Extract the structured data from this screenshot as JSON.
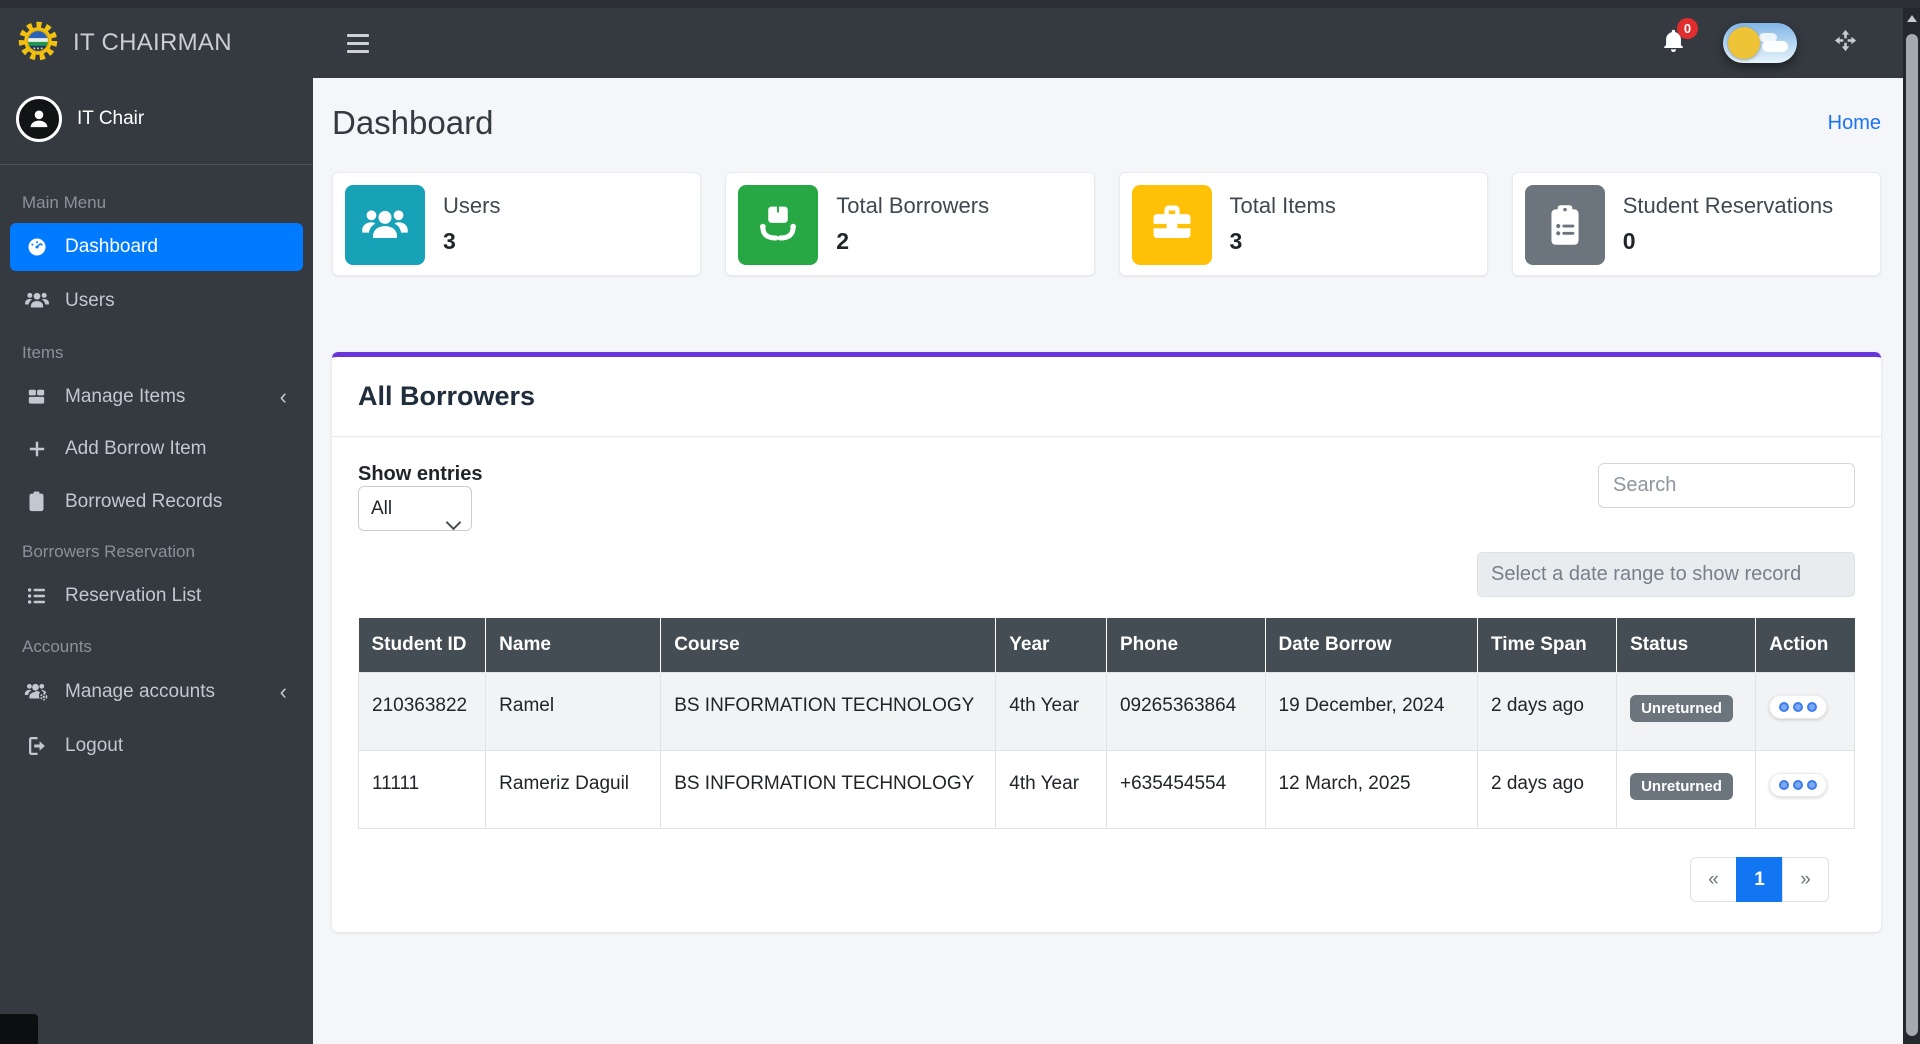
{
  "colors": {
    "navbar_bg": "#343a40",
    "sidebar_bg": "#343a40",
    "active_item_blue": "#007bff",
    "card_accent_purple": "#6935d8",
    "stat_teal": "#17a2b8",
    "stat_green": "#28a745",
    "stat_yellow": "#ffc107",
    "stat_gray": "#6c757d",
    "badge_red": "#e02d2d",
    "table_header_bg": "#444c54",
    "status_badge_gray": "#6c757d",
    "pagination_active_blue": "#1276f3",
    "link_blue": "#1b73f0"
  },
  "topbar": {
    "notification_count": "0",
    "icons": [
      "hamburger-icon",
      "bell-icon",
      "day-night-toggle",
      "expand-icon"
    ]
  },
  "brand": {
    "title": "IT CHAIRMAN",
    "logo_icon": "university-seal-gear-logo"
  },
  "user_panel": {
    "name": "IT Chair",
    "avatar_icon": "person-icon"
  },
  "sidebar": {
    "sections": [
      {
        "header": "Main Menu",
        "items": [
          {
            "label": "Dashboard",
            "icon": "tachometer-icon",
            "active": true
          },
          {
            "label": "Users",
            "icon": "users-icon"
          }
        ]
      },
      {
        "header": "Items",
        "items": [
          {
            "label": "Manage Items",
            "icon": "box-icon",
            "chevron": "‹"
          },
          {
            "label": "Add Borrow Item",
            "icon": "plus-icon"
          },
          {
            "label": "Borrowed Records",
            "icon": "clipboard-icon"
          }
        ]
      },
      {
        "header": "Borrowers Reservation",
        "items": [
          {
            "label": "Reservation List",
            "icon": "list-icon"
          }
        ]
      },
      {
        "header": "Accounts",
        "items": [
          {
            "label": "Manage accounts",
            "icon": "users-gear-icon",
            "chevron": "‹"
          },
          {
            "label": "Logout",
            "icon": "logout-icon"
          }
        ]
      }
    ]
  },
  "content_header": {
    "title": "Dashboard",
    "home_link": "Home"
  },
  "stat_cards": [
    {
      "label": "Users",
      "value": "3",
      "icon": "users-icon",
      "color": "#17a2b8"
    },
    {
      "label": "Total Borrowers",
      "value": "2",
      "icon": "hand-holding-box-icon",
      "color": "#28a745"
    },
    {
      "label": "Total Items",
      "value": "3",
      "icon": "toolbox-icon",
      "color": "#ffc107"
    },
    {
      "label": "Student Reservations",
      "value": "0",
      "icon": "clipboard-list-icon",
      "color": "#6c757d"
    }
  ],
  "borrowers": {
    "title": "All Borrowers",
    "show_entries_label": "Show entries",
    "entries_selected": "All",
    "search_placeholder": "Search",
    "date_range_placeholder": "Select a date range to show record",
    "table": {
      "columns": [
        "Student ID",
        "Name",
        "Course",
        "Year",
        "Phone",
        "Date Borrow",
        "Time Span",
        "Status",
        "Action"
      ],
      "rows": [
        {
          "student_id": "210363822",
          "name": "Ramel",
          "course": "BS INFORMATION TECHNOLOGY",
          "year": "4th Year",
          "phone": "09265363864",
          "date_borrow": "19 December, 2024",
          "time_span": "2 days ago",
          "status": "Unreturned"
        },
        {
          "student_id": "11111",
          "name": "Rameriz Daguil",
          "course": "BS INFORMATION TECHNOLOGY",
          "year": "4th Year",
          "phone": "+635454554",
          "date_borrow": "12 March, 2025",
          "time_span": "2 days ago",
          "status": "Unreturned"
        }
      ]
    },
    "pagination": {
      "prev": "«",
      "page": "1",
      "next": "»"
    }
  }
}
